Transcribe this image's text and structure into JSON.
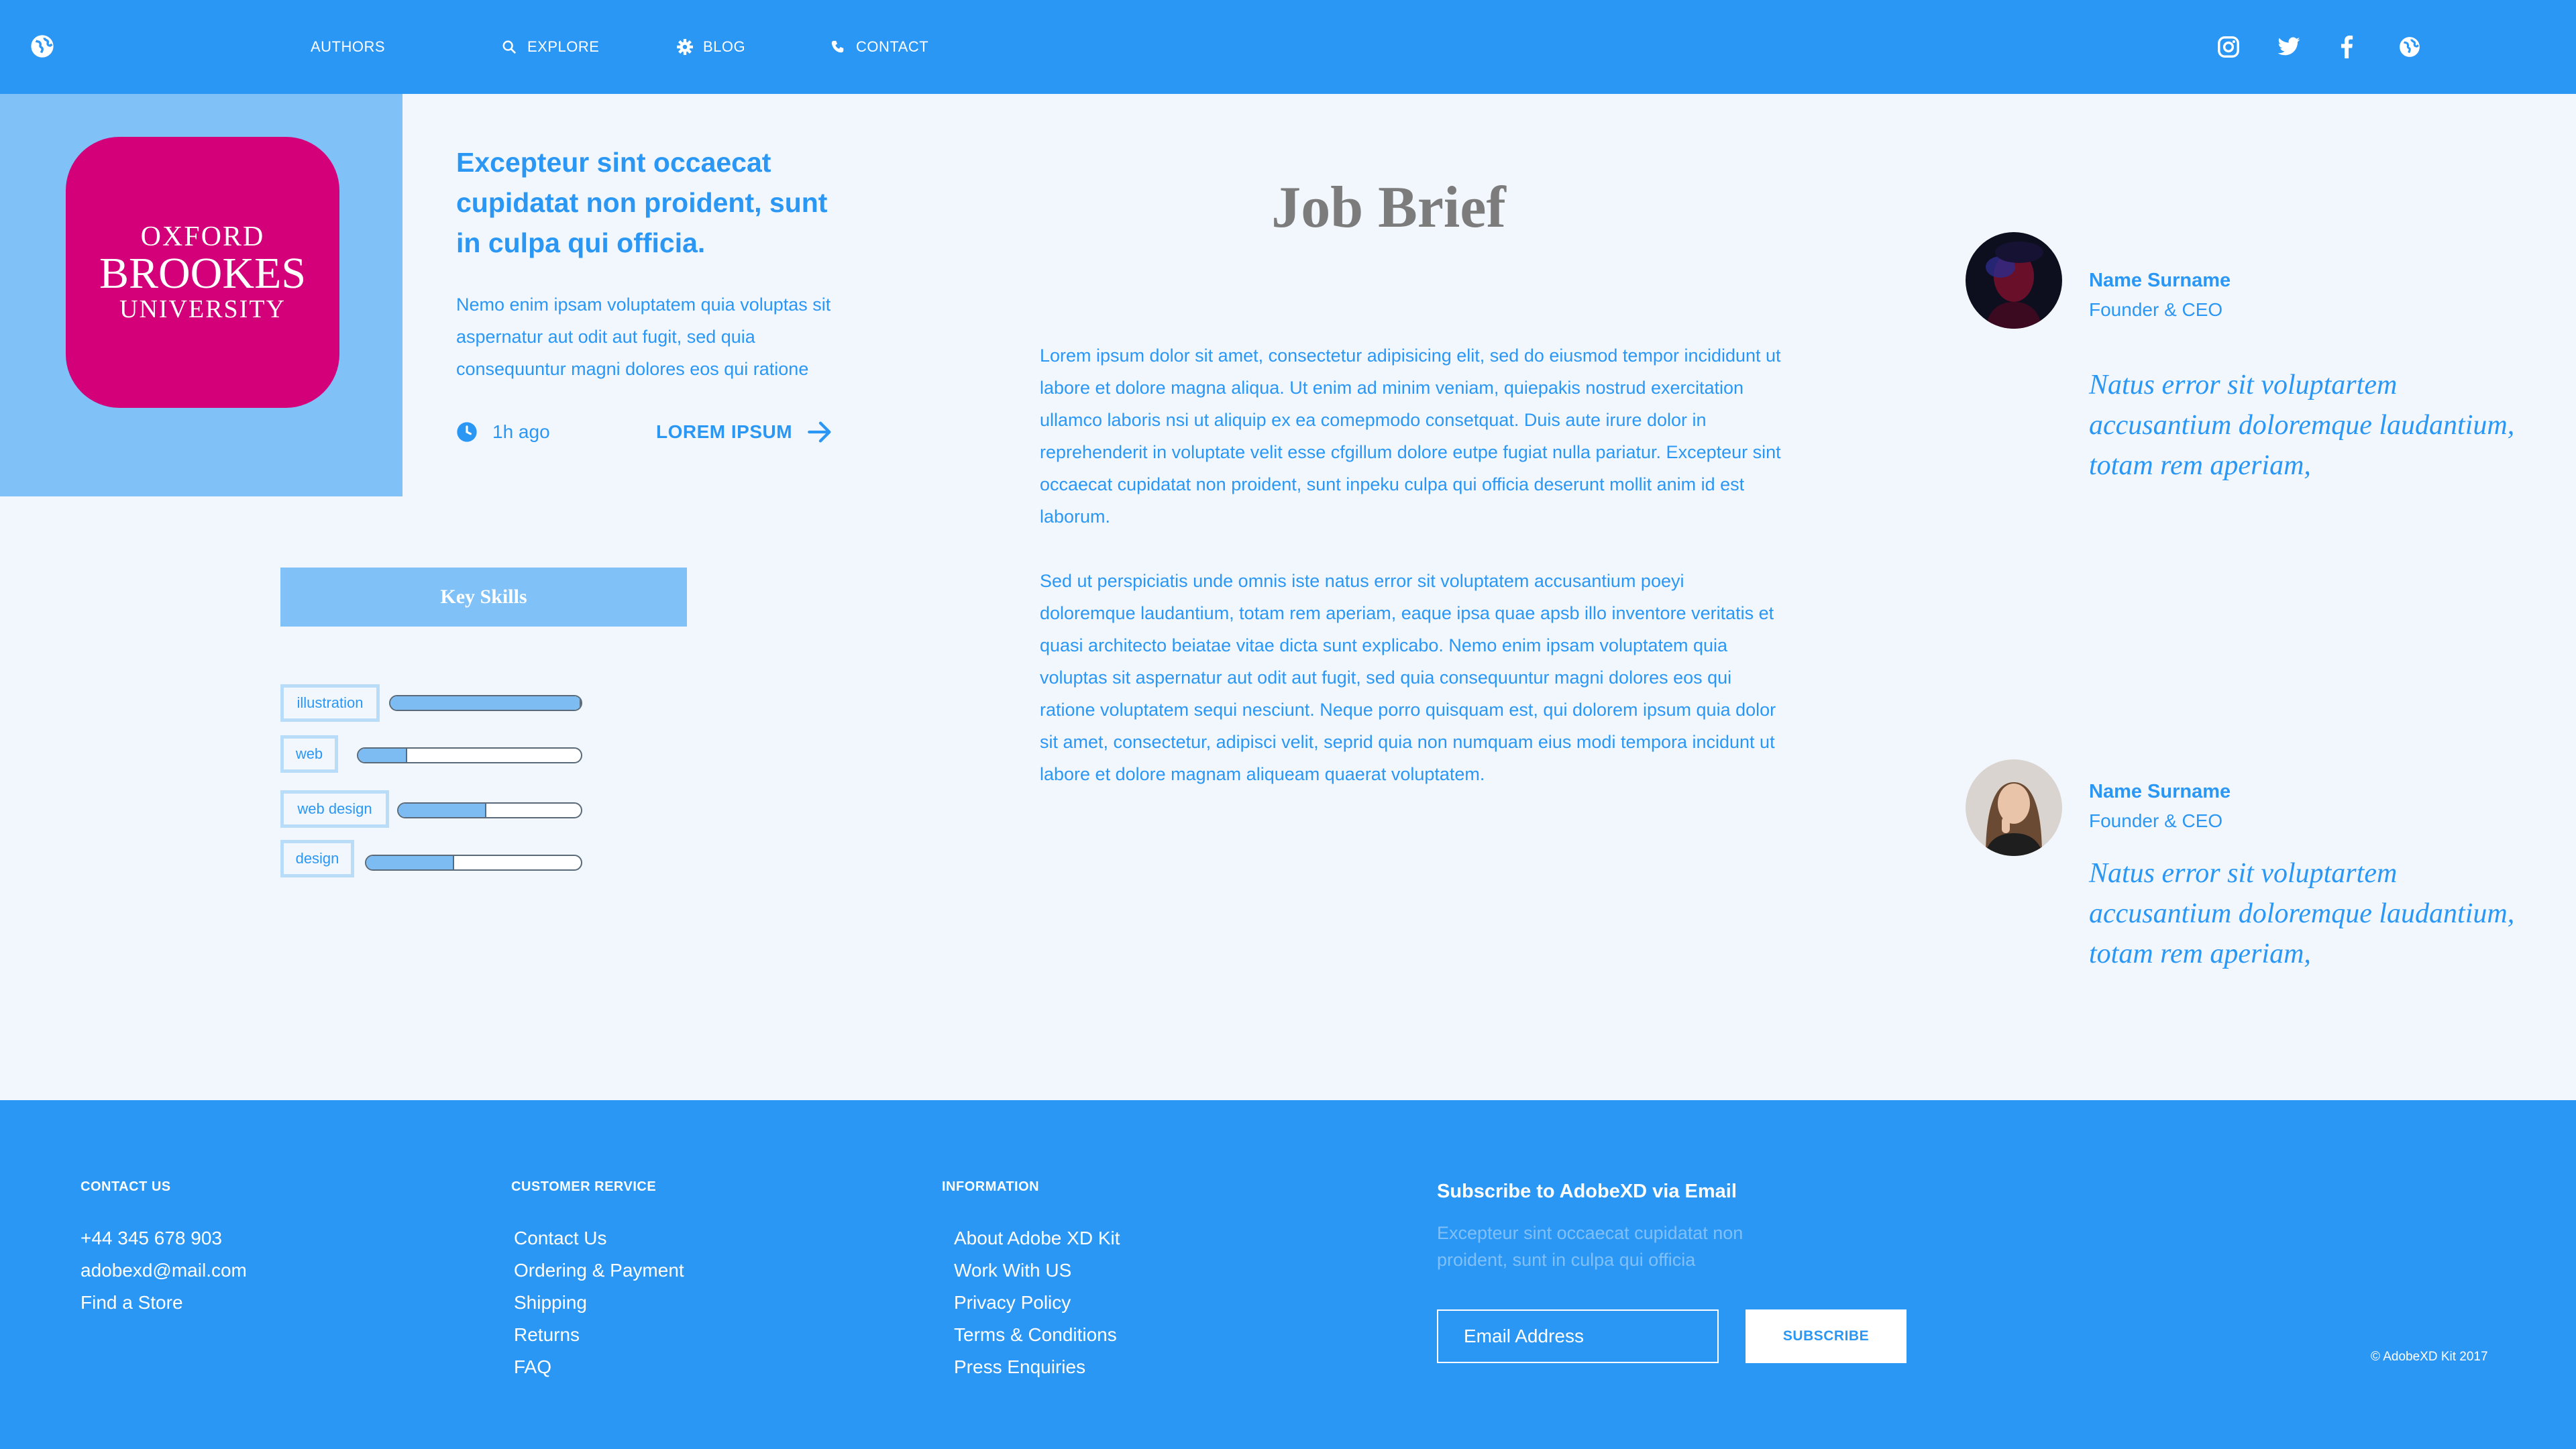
{
  "nav": {
    "items": [
      {
        "label": "AUTHORS"
      },
      {
        "label": "EXPLORE"
      },
      {
        "label": "BLOG"
      },
      {
        "label": "CONTACT"
      }
    ]
  },
  "hero": {
    "logo": {
      "line1": "OXFORD",
      "line2": "BROOKES",
      "line3": "UNIVERSITY"
    },
    "title": "Excepteur sint occaecat cupidatat non proident, sunt in culpa qui officia.",
    "description": "Nemo enim ipsam voluptatem quia voluptas sit aspernatur aut odit aut fugit, sed quia consequuntur magni dolores eos qui ratione",
    "time": "1h ago",
    "link_label": "LOREM IPSUM"
  },
  "skills": {
    "title": "Key Skills",
    "items": [
      {
        "label": "illustration",
        "level": 1.0
      },
      {
        "label": "web",
        "level": 0.22
      },
      {
        "label": "web design",
        "level": 0.48
      },
      {
        "label": "design",
        "level": 0.41
      }
    ]
  },
  "brief": {
    "title": "Job Brief",
    "paragraph1": "Lorem ipsum dolor sit amet, consectetur adipisicing elit, sed do eiusmod tempor incididunt ut labore et dolore magna aliqua. Ut enim ad minim veniam, quiepakis nostrud exercitation ullamco laboris nsi ut aliquip ex ea comepmodo consetquat. Duis aute irure dolor in reprehenderit in voluptate velit esse cfgillum dolore eutpe fugiat nulla pariatur. Excepteur sint occaecat cupidatat non proident, sunt inpeku culpa qui officia deserunt mollit anim id est laborum.",
    "paragraph2": "Sed ut perspiciatis unde omnis iste natus error sit voluptatem accusantium poeyi doloremque laudantium, totam rem aperiam, eaque ipsa quae apsb illo inventore veritatis et quasi architecto beiatae vitae dicta sunt explicabo. Nemo enim ipsam voluptatem quia voluptas sit aspernatur aut odit aut fugit, sed quia consequuntur magni dolores eos qui ratione voluptatem sequi nesciunt. Neque porro quisquam est, qui dolorem ipsum quia dolor sit amet, consectetur, adipisci velit, seprid quia non numquam eius modi tempora incidunt ut labore et dolore magnam aliqueam quaerat voluptatem."
  },
  "testimonials": [
    {
      "name": "Name Surname",
      "role": "Founder & CEO",
      "quote": "Natus error sit voluptartem accusantium doloremque laudantium, totam rem aperiam,"
    },
    {
      "name": "Name Surname",
      "role": "Founder & CEO",
      "quote": "Natus error sit voluptartem accusantium doloremque laudantium, totam rem aperiam,"
    }
  ],
  "footer": {
    "contact": {
      "heading": "CONTACT US",
      "items": [
        "+44 345 678 903",
        "adobexd@mail.com",
        "Find a Store"
      ]
    },
    "service": {
      "heading": "CUSTOMER RERVICE",
      "items": [
        "Contact Us",
        "Ordering & Payment",
        "Shipping",
        "Returns",
        "FAQ"
      ]
    },
    "information": {
      "heading": "INFORMATION",
      "items": [
        "About Adobe XD Kit",
        "Work With US",
        "Privacy Policy",
        "Terms & Conditions",
        "Press Enquiries"
      ]
    },
    "subscribe": {
      "title": "Subscribe to AdobeXD via Email",
      "description": "Excepteur sint occaecat cupidatat non proident, sunt in culpa qui officia",
      "placeholder": "Email Address",
      "button": "SUBSCRIBE"
    },
    "copyright": "© AdobeXD Kit 2017"
  },
  "colors": {
    "primary": "#2b97f5",
    "light": "#80c1f8",
    "background": "#f1f7fd",
    "logo_bg": "#d3007a",
    "heading_gray": "#7c7c7c"
  },
  "icons": {
    "nav_left": "globe-icon",
    "nav": [
      "search-icon",
      "gear-icon",
      "phone-icon"
    ],
    "social": [
      "instagram-icon",
      "twitter-icon",
      "facebook-icon",
      "globe-icon"
    ],
    "time": "clock-icon",
    "link": "arrow-right-icon"
  }
}
